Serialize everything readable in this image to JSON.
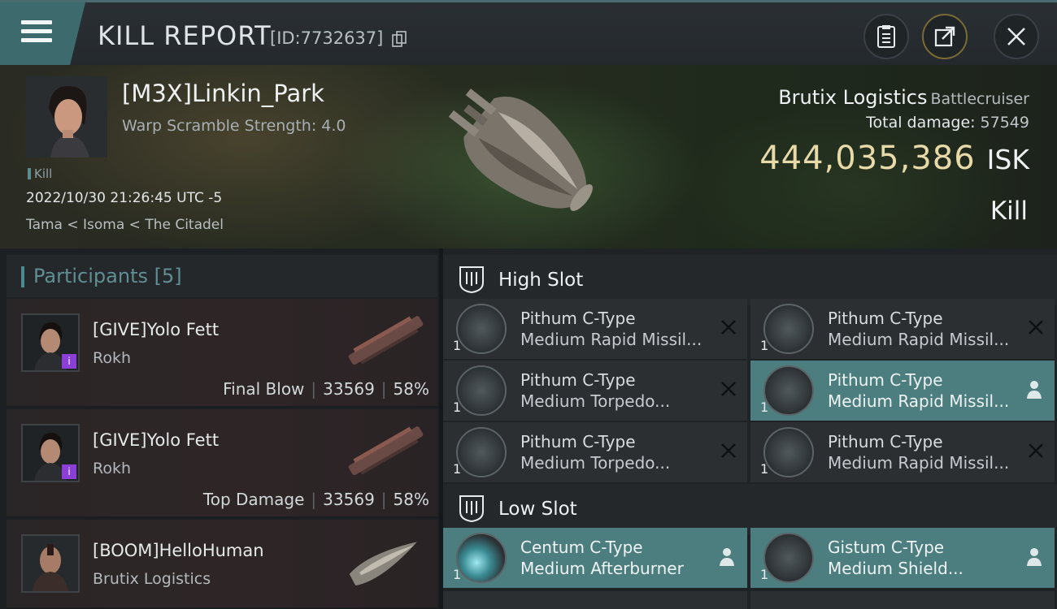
{
  "header": {
    "title": "KILL REPORT",
    "report_id": "[ID:7732637]"
  },
  "victim": {
    "name": "[M3X]Linkin_Park",
    "warp_scramble": "Warp Scramble Strength: 4.0",
    "kill_tag": "Kill",
    "datetime": "2022/10/30 21:26:45 UTC -5",
    "location": "Tama < Isoma < The Citadel",
    "ship_name": "Brutix Logistics",
    "ship_class": "Battlecruiser",
    "total_damage_label": "Total damage:",
    "total_damage": "57549",
    "isk_value": "444,035,386",
    "isk_unit": "ISK",
    "result": "Kill"
  },
  "participants": {
    "title": "Participants",
    "count": "[5]",
    "rows": [
      {
        "name": "[GIVE]Yolo Fett",
        "ship": "Rokh",
        "tag": "Final Blow",
        "damage": "33569",
        "percent": "58%"
      },
      {
        "name": "[GIVE]Yolo Fett",
        "ship": "Rokh",
        "tag": "Top Damage",
        "damage": "33569",
        "percent": "58%"
      },
      {
        "name": "[BOOM]HelloHuman",
        "ship": "Brutix Logistics",
        "tag": "",
        "damage": "",
        "percent": ""
      }
    ]
  },
  "high_slot": {
    "title": "High Slot",
    "items": [
      {
        "line1": "Pithum C-Type",
        "line2": "Medium Rapid Missil...",
        "qty": "1",
        "state": "destroyed",
        "icon": "missile-launcher-icon"
      },
      {
        "line1": "Pithum C-Type",
        "line2": "Medium Rapid Missil...",
        "qty": "1",
        "state": "destroyed",
        "icon": "missile-launcher-icon"
      },
      {
        "line1": "Pithum C-Type",
        "line2": "Medium Torpedo...",
        "qty": "1",
        "state": "destroyed",
        "icon": "torpedo-launcher-icon"
      },
      {
        "line1": "Pithum C-Type",
        "line2": "Medium Rapid Missil...",
        "qty": "1",
        "state": "dropped",
        "icon": "missile-launcher-icon"
      },
      {
        "line1": "Pithum C-Type",
        "line2": "Medium Torpedo...",
        "qty": "1",
        "state": "destroyed",
        "icon": "torpedo-launcher-icon"
      },
      {
        "line1": "Pithum C-Type",
        "line2": "Medium Rapid Missil...",
        "qty": "1",
        "state": "destroyed",
        "icon": "missile-launcher-icon"
      }
    ]
  },
  "low_slot": {
    "title": "Low Slot",
    "items": [
      {
        "line1": "Centum C-Type",
        "line2": "Medium Afterburner",
        "qty": "1",
        "state": "dropped",
        "icon": "afterburner-icon"
      },
      {
        "line1": "Gistum C-Type",
        "line2": "Medium Shield...",
        "qty": "1",
        "state": "dropped",
        "icon": "shield-module-icon"
      }
    ]
  },
  "colors": {
    "accent_teal": "#4c7d7f",
    "isk_gold": "#e8d9a8",
    "corp_badge": "#8b3fd6"
  }
}
